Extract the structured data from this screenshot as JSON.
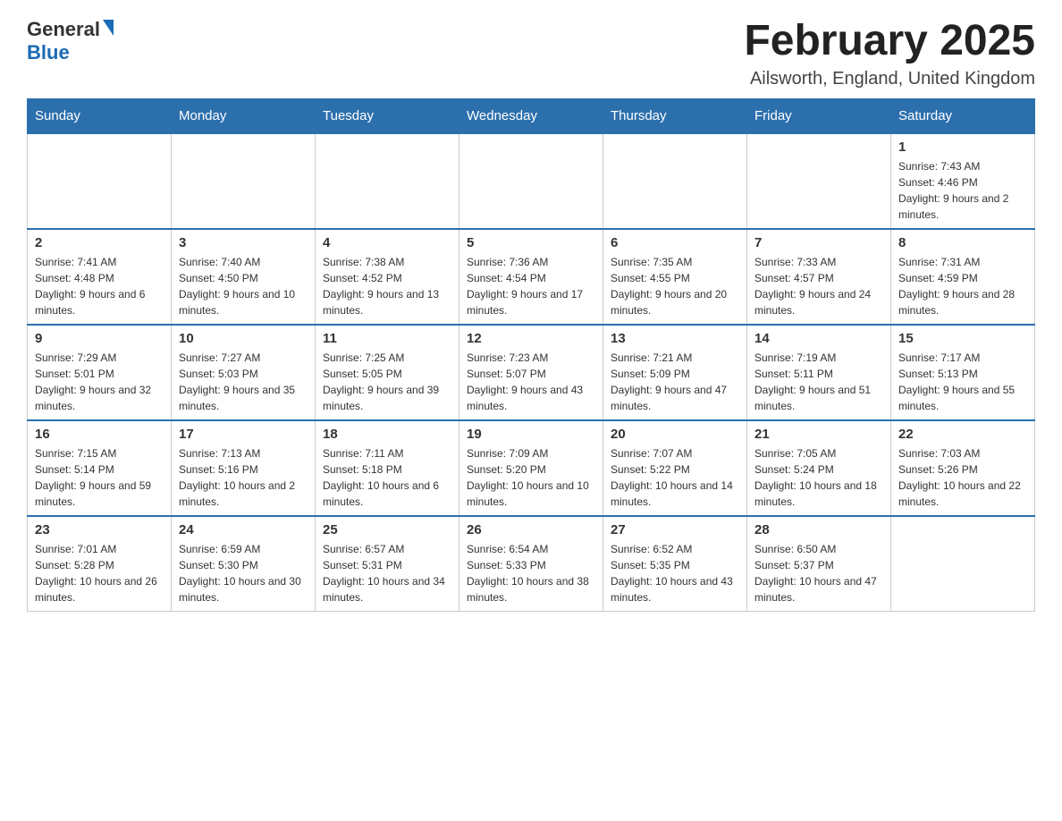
{
  "header": {
    "logo": {
      "general": "General",
      "blue": "Blue"
    },
    "title": "February 2025",
    "location": "Ailsworth, England, United Kingdom"
  },
  "days_of_week": [
    "Sunday",
    "Monday",
    "Tuesday",
    "Wednesday",
    "Thursday",
    "Friday",
    "Saturday"
  ],
  "weeks": [
    [
      {
        "day": "",
        "info": ""
      },
      {
        "day": "",
        "info": ""
      },
      {
        "day": "",
        "info": ""
      },
      {
        "day": "",
        "info": ""
      },
      {
        "day": "",
        "info": ""
      },
      {
        "day": "",
        "info": ""
      },
      {
        "day": "1",
        "info": "Sunrise: 7:43 AM\nSunset: 4:46 PM\nDaylight: 9 hours and 2 minutes."
      }
    ],
    [
      {
        "day": "2",
        "info": "Sunrise: 7:41 AM\nSunset: 4:48 PM\nDaylight: 9 hours and 6 minutes."
      },
      {
        "day": "3",
        "info": "Sunrise: 7:40 AM\nSunset: 4:50 PM\nDaylight: 9 hours and 10 minutes."
      },
      {
        "day": "4",
        "info": "Sunrise: 7:38 AM\nSunset: 4:52 PM\nDaylight: 9 hours and 13 minutes."
      },
      {
        "day": "5",
        "info": "Sunrise: 7:36 AM\nSunset: 4:54 PM\nDaylight: 9 hours and 17 minutes."
      },
      {
        "day": "6",
        "info": "Sunrise: 7:35 AM\nSunset: 4:55 PM\nDaylight: 9 hours and 20 minutes."
      },
      {
        "day": "7",
        "info": "Sunrise: 7:33 AM\nSunset: 4:57 PM\nDaylight: 9 hours and 24 minutes."
      },
      {
        "day": "8",
        "info": "Sunrise: 7:31 AM\nSunset: 4:59 PM\nDaylight: 9 hours and 28 minutes."
      }
    ],
    [
      {
        "day": "9",
        "info": "Sunrise: 7:29 AM\nSunset: 5:01 PM\nDaylight: 9 hours and 32 minutes."
      },
      {
        "day": "10",
        "info": "Sunrise: 7:27 AM\nSunset: 5:03 PM\nDaylight: 9 hours and 35 minutes."
      },
      {
        "day": "11",
        "info": "Sunrise: 7:25 AM\nSunset: 5:05 PM\nDaylight: 9 hours and 39 minutes."
      },
      {
        "day": "12",
        "info": "Sunrise: 7:23 AM\nSunset: 5:07 PM\nDaylight: 9 hours and 43 minutes."
      },
      {
        "day": "13",
        "info": "Sunrise: 7:21 AM\nSunset: 5:09 PM\nDaylight: 9 hours and 47 minutes."
      },
      {
        "day": "14",
        "info": "Sunrise: 7:19 AM\nSunset: 5:11 PM\nDaylight: 9 hours and 51 minutes."
      },
      {
        "day": "15",
        "info": "Sunrise: 7:17 AM\nSunset: 5:13 PM\nDaylight: 9 hours and 55 minutes."
      }
    ],
    [
      {
        "day": "16",
        "info": "Sunrise: 7:15 AM\nSunset: 5:14 PM\nDaylight: 9 hours and 59 minutes."
      },
      {
        "day": "17",
        "info": "Sunrise: 7:13 AM\nSunset: 5:16 PM\nDaylight: 10 hours and 2 minutes."
      },
      {
        "day": "18",
        "info": "Sunrise: 7:11 AM\nSunset: 5:18 PM\nDaylight: 10 hours and 6 minutes."
      },
      {
        "day": "19",
        "info": "Sunrise: 7:09 AM\nSunset: 5:20 PM\nDaylight: 10 hours and 10 minutes."
      },
      {
        "day": "20",
        "info": "Sunrise: 7:07 AM\nSunset: 5:22 PM\nDaylight: 10 hours and 14 minutes."
      },
      {
        "day": "21",
        "info": "Sunrise: 7:05 AM\nSunset: 5:24 PM\nDaylight: 10 hours and 18 minutes."
      },
      {
        "day": "22",
        "info": "Sunrise: 7:03 AM\nSunset: 5:26 PM\nDaylight: 10 hours and 22 minutes."
      }
    ],
    [
      {
        "day": "23",
        "info": "Sunrise: 7:01 AM\nSunset: 5:28 PM\nDaylight: 10 hours and 26 minutes."
      },
      {
        "day": "24",
        "info": "Sunrise: 6:59 AM\nSunset: 5:30 PM\nDaylight: 10 hours and 30 minutes."
      },
      {
        "day": "25",
        "info": "Sunrise: 6:57 AM\nSunset: 5:31 PM\nDaylight: 10 hours and 34 minutes."
      },
      {
        "day": "26",
        "info": "Sunrise: 6:54 AM\nSunset: 5:33 PM\nDaylight: 10 hours and 38 minutes."
      },
      {
        "day": "27",
        "info": "Sunrise: 6:52 AM\nSunset: 5:35 PM\nDaylight: 10 hours and 43 minutes."
      },
      {
        "day": "28",
        "info": "Sunrise: 6:50 AM\nSunset: 5:37 PM\nDaylight: 10 hours and 47 minutes."
      },
      {
        "day": "",
        "info": ""
      }
    ]
  ]
}
